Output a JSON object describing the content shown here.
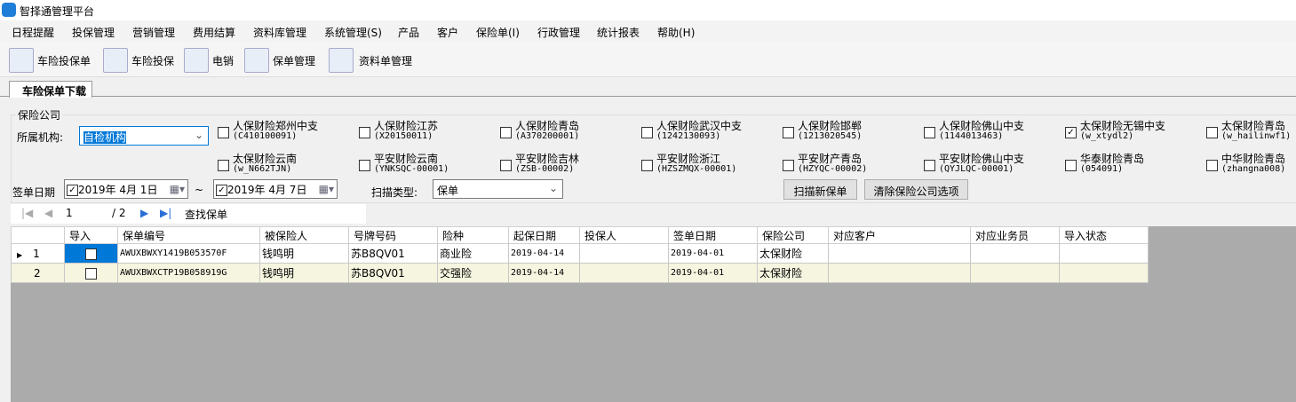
{
  "app": {
    "title": "智择通管理平台"
  },
  "menu": [
    "日程提醒",
    "投保管理",
    "营销管理",
    "费用结算",
    "资料库管理",
    "系统管理(S)",
    "产品",
    "客户",
    "保险单(I)",
    "行政管理",
    "统计报表",
    "帮助(H)"
  ],
  "toolbar": [
    {
      "label": "车险投保单",
      "icon": "spreadsheet-icon"
    },
    {
      "label": "车险投保",
      "icon": "document-pencil-icon"
    },
    {
      "label": "电销",
      "icon": "contact-card-icon"
    },
    {
      "label": "保单管理",
      "icon": "checklist-pencil-icon"
    },
    {
      "label": "资料单管理",
      "icon": "blank-document-icon"
    }
  ],
  "tab": "车险保单下载",
  "filters": {
    "group_label": "保险公司",
    "org_label": "所属机构:",
    "org_value": "自检机构",
    "companies": [
      {
        "name": "人保财险郑州中支",
        "code": "(C410100091)",
        "checked": false
      },
      {
        "name": "人保财险江苏",
        "code": "(X20150011)",
        "checked": false
      },
      {
        "name": "人保财险青岛",
        "code": "(A370200001)",
        "checked": false
      },
      {
        "name": "人保财险武汉中支",
        "code": "(1242130093)",
        "checked": false
      },
      {
        "name": "人保财险邯郸",
        "code": "(1213020545)",
        "checked": false
      },
      {
        "name": "人保财险佛山中支",
        "code": "(1144013463)",
        "checked": false
      },
      {
        "name": "太保财险无锡中支",
        "code": "(w_xtydl2)",
        "checked": true
      },
      {
        "name": "太保财险青岛",
        "code": "(w_hailinwf1)",
        "checked": false
      },
      {
        "name": "太保财险云南",
        "code": "(w_N662TJN)",
        "checked": false
      },
      {
        "name": "平安财险云南",
        "code": "(YNKSQC-00001)",
        "checked": false
      },
      {
        "name": "平安财险吉林",
        "code": "(ZSB-00002)",
        "checked": false
      },
      {
        "name": "平安财险浙江",
        "code": "(HZSZMQX-00001)",
        "checked": false
      },
      {
        "name": "平安财产青岛",
        "code": "(HZYQC-00002)",
        "checked": false
      },
      {
        "name": "平安财险佛山中支",
        "code": "(QYJLQC-00001)",
        "checked": false
      },
      {
        "name": "华泰财险青岛",
        "code": "(054091)",
        "checked": false
      },
      {
        "name": "中华财险青岛",
        "code": "(zhangna008)",
        "checked": false
      }
    ],
    "date_label": "签单日期",
    "date_from": "2019年 4月 1日",
    "date_sep": "~",
    "date_to": "2019年 4月 7日",
    "scan_type_label": "扫描类型:",
    "scan_type_value": "保单",
    "scan_button": "扫描新保单",
    "clear_button": "清除保险公司选项"
  },
  "nav": {
    "page": "1",
    "total": "/ 2",
    "find": "查找保单"
  },
  "grid": {
    "columns": [
      "导入",
      "保单编号",
      "被保险人",
      "号牌号码",
      "险种",
      "起保日期",
      "投保人",
      "签单日期",
      "保险公司",
      "对应客户",
      "对应业务员",
      "导入状态"
    ],
    "rows": [
      {
        "n": "1",
        "cells": [
          "AWUXBWXY1419B053570F",
          "钱鸣明",
          "苏B8QV01",
          "商业险",
          "2019-04-14",
          "",
          "2019-04-01",
          "太保财险",
          "",
          "",
          ""
        ]
      },
      {
        "n": "2",
        "cells": [
          "AWUXBWXCTP19B058919G",
          "钱鸣明",
          "苏B8QV01",
          "交强险",
          "2019-04-14",
          "",
          "2019-04-01",
          "太保财险",
          "",
          "",
          ""
        ]
      }
    ]
  }
}
